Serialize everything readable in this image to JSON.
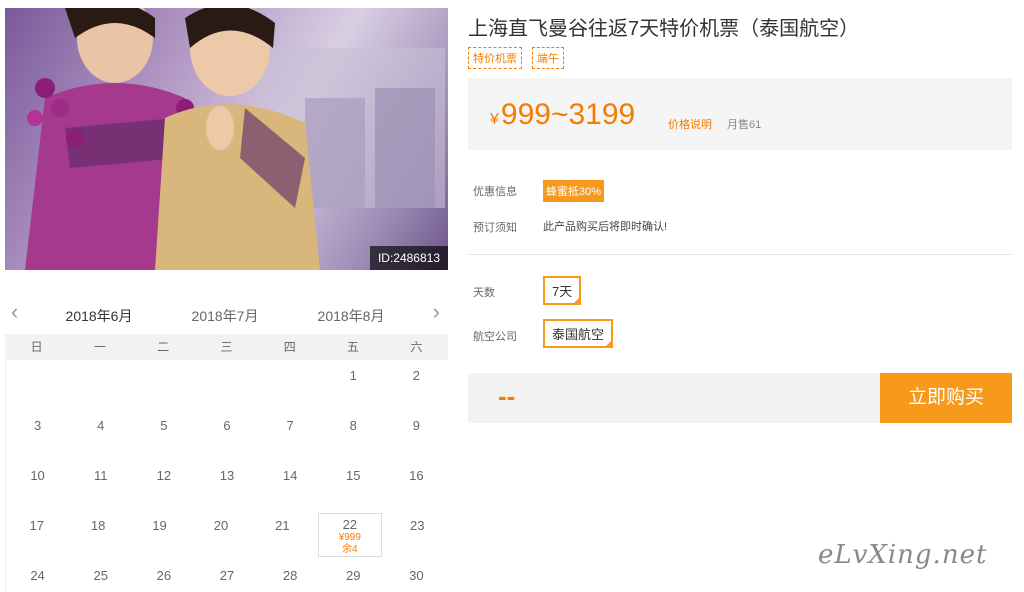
{
  "photo": {
    "id_label": "ID:2486813"
  },
  "calendar": {
    "months": [
      "2018年6月",
      "2018年7月",
      "2018年8月"
    ],
    "weekdays": [
      "日",
      "一",
      "二",
      "三",
      "四",
      "五",
      "六"
    ],
    "rows": [
      [
        "",
        "",
        "",
        "",
        "",
        "1",
        "2"
      ],
      [
        "3",
        "4",
        "5",
        "6",
        "7",
        "8",
        "9"
      ],
      [
        "10",
        "11",
        "12",
        "13",
        "14",
        "15",
        "16"
      ],
      [
        "17",
        "18",
        "19",
        "20",
        "21",
        "22",
        "23"
      ],
      [
        "24",
        "25",
        "26",
        "27",
        "28",
        "29",
        "30"
      ]
    ],
    "selected": {
      "day": "22",
      "price": "¥999",
      "remain": "余4"
    }
  },
  "product": {
    "title": "上海直飞曼谷往返7天特价机票（泰国航空）",
    "tags": [
      "特价机票",
      "端午"
    ],
    "price_symbol": "¥",
    "price_range": "999~3199",
    "price_note": "价格说明",
    "sales": "月售61",
    "promo_label": "优惠信息",
    "promo_value": "蜂蜜抵30%",
    "notice_label": "预订须知",
    "notice_value": "此产品购买后将即时确认!",
    "days_label": "天数",
    "days_value": "7天",
    "airline_label": "航空公司",
    "airline_value": "泰国航空",
    "total": "--",
    "buy_label": "立即购买"
  },
  "watermark": "eLvXing.net",
  "colors": {
    "accent": "#f79a1b",
    "price": "#f57c00"
  }
}
